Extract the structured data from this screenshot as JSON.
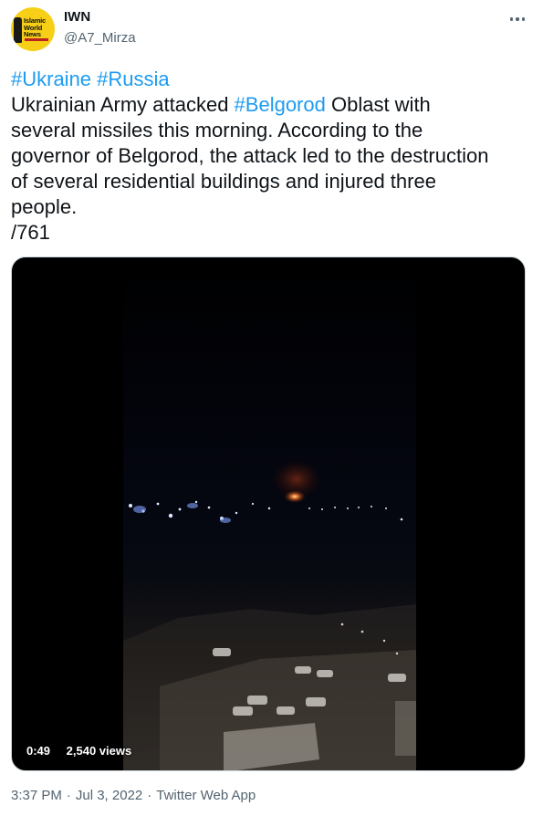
{
  "author": {
    "display_name": "IWN",
    "handle": "@A7_Mirza",
    "avatar_logo_lines": [
      "Islamic",
      "World",
      "News"
    ],
    "avatar_color": "#f6cf16"
  },
  "tweet": {
    "hashtag_ukraine": "#Ukraine",
    "hashtag_russia": "#Russia",
    "text_before_tag": "Ukrainian Army attacked ",
    "hashtag_belgorod": "#Belgorod",
    "text_after_tag": " Oblast with",
    "line2": "several missiles this morning. According to the",
    "line3": "governor of Belgorod, the attack led to the destruction",
    "line4": "of several residential buildings and injured three",
    "line5": "people.",
    "line6": "/761"
  },
  "video": {
    "duration": "0:49",
    "views": "2,540 views"
  },
  "footer": {
    "time": "3:37 PM",
    "date": "Jul 3, 2022",
    "source": "Twitter Web App"
  },
  "colors": {
    "link": "#1d9bf0",
    "secondary_text": "#536471",
    "primary_text": "#0f1419"
  },
  "icons": {
    "more": "more-horizontal-icon"
  }
}
